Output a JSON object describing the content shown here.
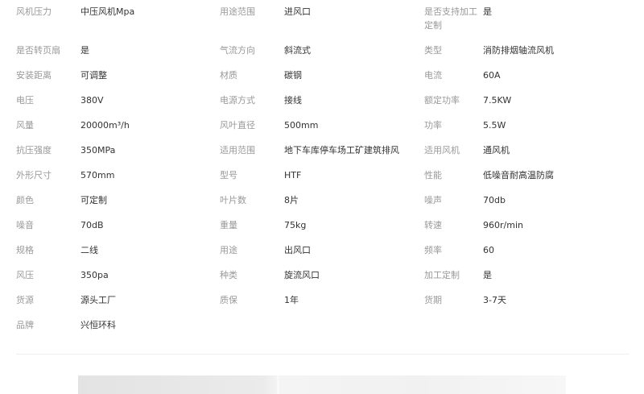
{
  "specs": {
    "rows": [
      [
        {
          "label": "风机压力",
          "value": "中压风机Mpa"
        },
        {
          "label": "用途范围",
          "value": "进风口"
        },
        {
          "label": "是否支持加工定制",
          "value": "是"
        }
      ],
      [
        {
          "label": "是否转页扇",
          "value": "是"
        },
        {
          "label": "气流方向",
          "value": "斜流式"
        },
        {
          "label": "类型",
          "value": "消防排烟轴流风机"
        }
      ],
      [
        {
          "label": "安装距离",
          "value": "可调整"
        },
        {
          "label": "材质",
          "value": "碳钢"
        },
        {
          "label": "电流",
          "value": "60A"
        }
      ],
      [
        {
          "label": "电压",
          "value": "380V"
        },
        {
          "label": "电源方式",
          "value": "接线"
        },
        {
          "label": "额定功率",
          "value": "7.5KW"
        }
      ],
      [
        {
          "label": "风量",
          "value": "20000m³/h"
        },
        {
          "label": "风叶直径",
          "value": "500mm"
        },
        {
          "label": "功率",
          "value": "5.5W"
        }
      ],
      [
        {
          "label": "抗压强度",
          "value": "350MPa"
        },
        {
          "label": "适用范围",
          "value": "地下车库停车场工矿建筑排风"
        },
        {
          "label": "适用风机",
          "value": "通风机"
        }
      ],
      [
        {
          "label": "外形尺寸",
          "value": "570mm"
        },
        {
          "label": "型号",
          "value": "HTF"
        },
        {
          "label": "性能",
          "value": "低噪音耐高温防腐"
        }
      ],
      [
        {
          "label": "颜色",
          "value": "可定制"
        },
        {
          "label": "叶片数",
          "value": "8片"
        },
        {
          "label": "噪声",
          "value": "70db"
        }
      ],
      [
        {
          "label": "噪音",
          "value": "70dB"
        },
        {
          "label": "重量",
          "value": "75kg"
        },
        {
          "label": "转速",
          "value": "960r/min"
        }
      ],
      [
        {
          "label": "规格",
          "value": "二线"
        },
        {
          "label": "用途",
          "value": "出风口"
        },
        {
          "label": "频率",
          "value": "60"
        }
      ],
      [
        {
          "label": "风压",
          "value": "350pa"
        },
        {
          "label": "种类",
          "value": "旋流风口"
        },
        {
          "label": "加工定制",
          "value": "是"
        }
      ],
      [
        {
          "label": "货源",
          "value": "源头工厂"
        },
        {
          "label": "质保",
          "value": "1年"
        },
        {
          "label": "货期",
          "value": "3-7天"
        }
      ],
      [
        {
          "label": "品牌",
          "value": "兴恒环科"
        }
      ]
    ]
  },
  "colors": {
    "label": "#999999",
    "value": "#333333",
    "divider": "#eeeeee"
  }
}
